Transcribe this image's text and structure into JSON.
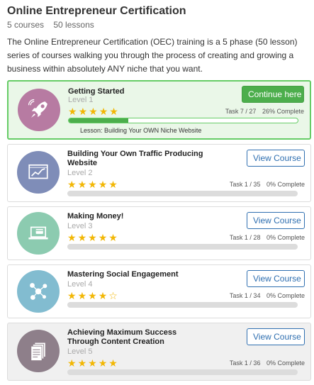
{
  "header": {
    "title": "Online Entrepreneur Certification",
    "courses": "5 courses",
    "lessons": "50 lessons",
    "description": "The Online Entrepreneur Certification (OEC) training is a 5 phase (50 lesson) series of courses walking you through the process of creating and growing a business within absolutely ANY niche that you want."
  },
  "colors": {
    "accent_green": "#4cae4c",
    "link_blue": "#2f6fb0",
    "star_gold": "#f2b705"
  },
  "courses": [
    {
      "name": "Getting Started",
      "level": "Level 1",
      "rating": 5,
      "task": "Task 7 / 27",
      "complete": "26% Complete",
      "progress": 0.26,
      "button": "Continue here",
      "lesson": "Lesson: Building Your OWN Niche Website",
      "icon": "rocket-icon",
      "circle_color": "#b77ba2"
    },
    {
      "name": "Building Your Own Traffic Producing Website",
      "level": "Level 2",
      "rating": 5,
      "task": "Task 1 / 35",
      "complete": "0% Complete",
      "progress": 0,
      "button": "View Course",
      "icon": "chart-monitor-icon",
      "circle_color": "#7f8db8"
    },
    {
      "name": "Making Money!",
      "level": "Level 3",
      "rating": 5,
      "task": "Task 1 / 28",
      "complete": "0% Complete",
      "progress": 0,
      "button": "View Course",
      "icon": "laptop-card-icon",
      "circle_color": "#8ccbb0"
    },
    {
      "name": "Mastering Social Engagement",
      "level": "Level 4",
      "rating": 4.5,
      "task": "Task 1 / 34",
      "complete": "0% Complete",
      "progress": 0,
      "button": "View Course",
      "icon": "social-network-icon",
      "circle_color": "#82bcd0"
    },
    {
      "name": "Achieving Maximum Success Through Content Creation",
      "level": "Level 5",
      "rating": 5,
      "task": "Task 1 / 36",
      "complete": "0% Complete",
      "progress": 0,
      "button": "View Course",
      "icon": "documents-icon",
      "circle_color": "#8e7f8a"
    }
  ]
}
